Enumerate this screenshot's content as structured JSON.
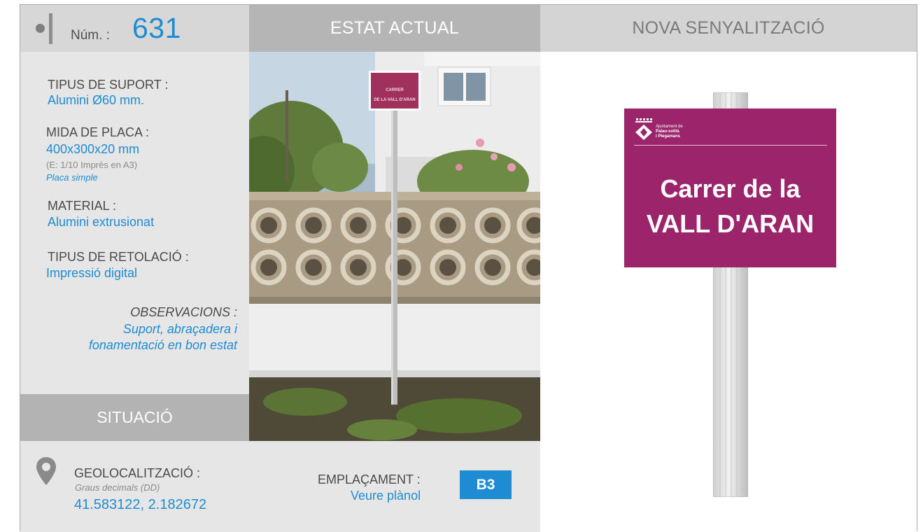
{
  "header": {
    "num_label": "Núm. :",
    "num_value": "631",
    "estat_actual": "ESTAT ACTUAL",
    "nova_senyalitzacio": "NOVA SENYALITZACIÓ"
  },
  "info": {
    "tipus_suport_label": "TIPUS DE SUPORT :",
    "tipus_suport_value": "Alumini Ø60 mm.",
    "mida_placa_label": "MIDA DE PLACA :",
    "mida_placa_value": "400x300x20 mm",
    "mida_placa_scale": "(E: 1/10 Imprès en A3)",
    "mida_placa_type": "Placa simple",
    "material_label": "MATERIAL :",
    "material_value": "Alumini extrusionat",
    "retolacio_label": "TIPUS DE RETOLACIÓ :",
    "retolacio_value": "Impressió digital",
    "observacions_label": "OBSERVACIONS :",
    "observacions_line1": "Suport, abraçadera i",
    "observacions_line2": "fonamentació en bon estat"
  },
  "situacio": {
    "title": "SITUACIÓ",
    "geo_label": "GEOLOCALITZACIÓ :",
    "geo_format": "Graus decimals (DD)",
    "geo_coords": "41.583122, 2.182672",
    "emplacament_label": "EMPLAÇAMENT :",
    "emplacament_link": "Veure plànol",
    "emplacament_code": "B3"
  },
  "photo": {
    "sign_line1": "CARRER",
    "sign_line2": "DE LA VALL D'ARAN"
  },
  "new_sign": {
    "logo_line1": "Ajuntament de",
    "logo_line2": "Palau-solità",
    "logo_line3": "i Plegamans",
    "line1": "Carrer de la",
    "line2": "VALL D'ARAN",
    "plate_color": "#9b246b"
  },
  "colors": {
    "accent": "#1d8cd3",
    "header_dark": "#b5b5b5",
    "header_light": "#d7d7d7",
    "panel": "#e6e6e6"
  }
}
